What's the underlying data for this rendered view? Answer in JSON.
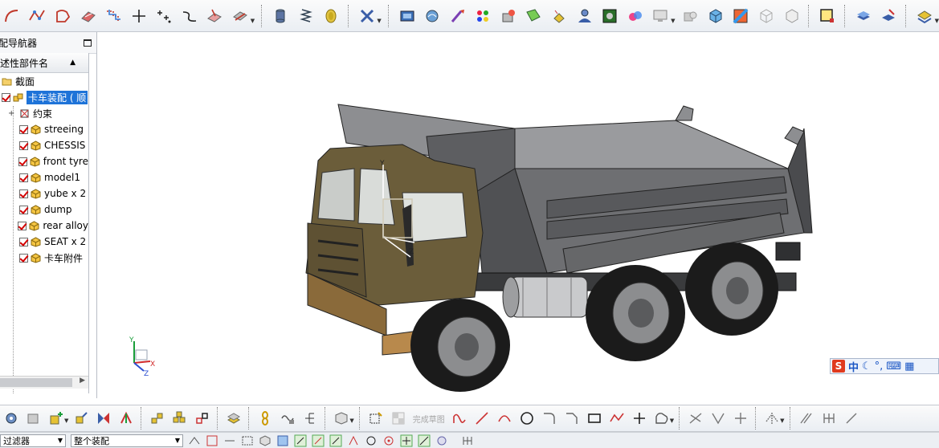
{
  "navigator": {
    "title": "配导航器",
    "column_header": "述性部件名",
    "tree": [
      {
        "label": "截面",
        "type": "folder",
        "indent": 0,
        "checked": false
      },
      {
        "label": "卡车装配 ( 顺",
        "type": "assembly",
        "indent": 0,
        "checked": true,
        "selected": true
      },
      {
        "label": "约束",
        "type": "constraints",
        "indent": 1,
        "checked": false,
        "expander": "+"
      },
      {
        "label": "streeing",
        "type": "part",
        "indent": 1,
        "checked": true
      },
      {
        "label": "CHESSIS",
        "type": "part",
        "indent": 1,
        "checked": true
      },
      {
        "label": "front tyre",
        "type": "part",
        "indent": 1,
        "checked": true
      },
      {
        "label": "model1",
        "type": "part",
        "indent": 1,
        "checked": true
      },
      {
        "label": "yube x 2",
        "type": "part",
        "indent": 1,
        "checked": true
      },
      {
        "label": "dump",
        "type": "part",
        "indent": 1,
        "checked": true
      },
      {
        "label": "rear alloy",
        "type": "part",
        "indent": 1,
        "checked": true
      },
      {
        "label": "SEAT x 2",
        "type": "part",
        "indent": 1,
        "checked": true
      },
      {
        "label": "卡车附件",
        "type": "part",
        "indent": 1,
        "checked": true
      }
    ]
  },
  "viewport": {
    "triad_labels": {
      "x": "X",
      "y": "Y",
      "z": "Z"
    },
    "model_triad": {
      "x": "X",
      "y": "Y",
      "z": "Z"
    }
  },
  "ime": {
    "logo": "S",
    "mode": "中"
  },
  "bottom_toolbar": {
    "sketch_label": "完成草图"
  },
  "selection_bar": {
    "filter_label": "过滤器",
    "scope_value": "整个装配"
  },
  "colors": {
    "selection": "#1e73d8",
    "cab": "#6b5d3a",
    "dump_body": "#7c7d80",
    "checkmark": "#d40000"
  }
}
